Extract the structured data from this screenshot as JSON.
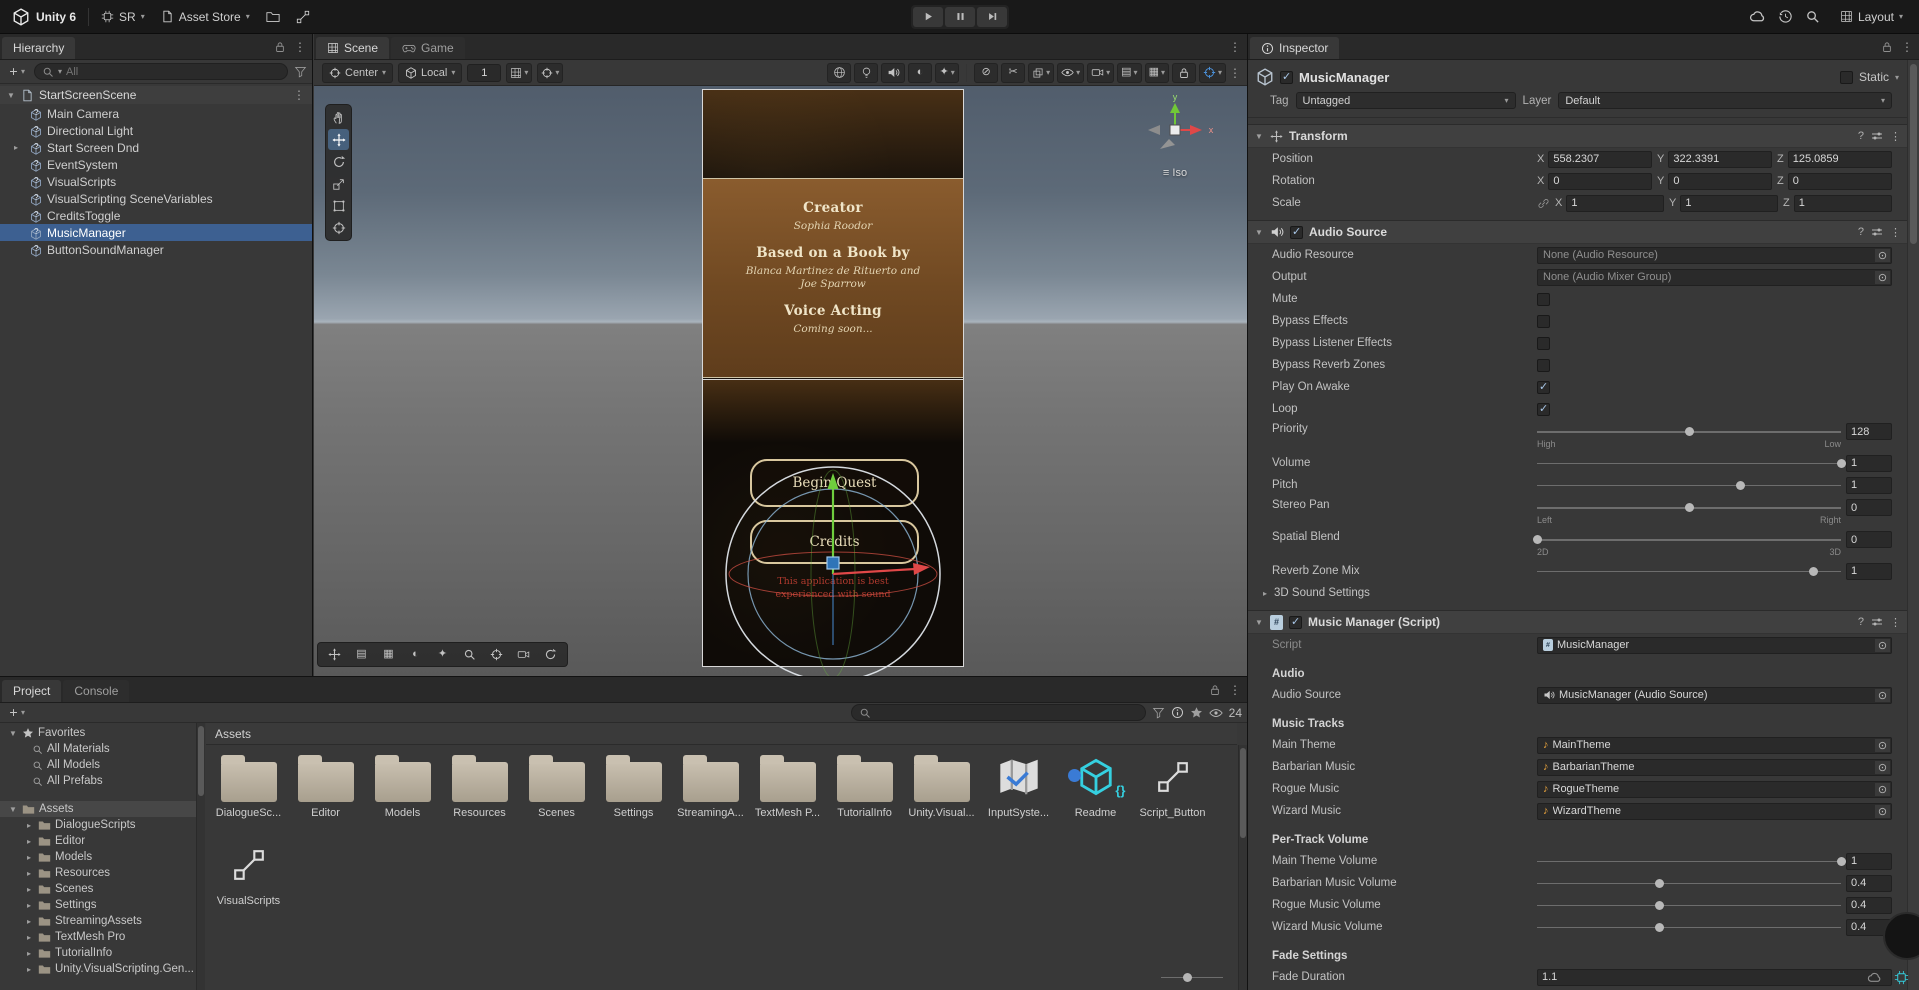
{
  "colors": {
    "selection_blue": "#3d6091",
    "accent_blue": "#4a90d9",
    "topbar_bg": "#191919",
    "panel_bg": "#383838",
    "folder_icon": "#b5ac9c",
    "audio_asset_orange": "#e8a33d",
    "visual_scripting_teal": "#35d0e0",
    "preview_panel_brown": "#7a5126",
    "preview_cream": "#ecdfc0",
    "preview_warning_red": "#b03a2e",
    "gizmo_green": "#6fce3e",
    "gizmo_red": "#e04848",
    "gizmo_blue": "#3a7bd5"
  },
  "topbar": {
    "app_title": "Unity 6",
    "sr_menu": "SR",
    "asset_store_menu": "Asset Store",
    "layout_menu": "Layout"
  },
  "hierarchy": {
    "tab_label": "Hierarchy",
    "search_placeholder": "All",
    "scene_name": "StartScreenScene",
    "items": [
      {
        "label": "Main Camera"
      },
      {
        "label": "Directional Light"
      },
      {
        "label": "Start Screen Dnd",
        "expandable": true
      },
      {
        "label": "EventSystem"
      },
      {
        "label": "VisualScripts"
      },
      {
        "label": "VisualScripting SceneVariables"
      },
      {
        "label": "CreditsToggle"
      },
      {
        "label": "MusicManager",
        "selected": true
      },
      {
        "label": "ButtonSoundManager"
      }
    ]
  },
  "scene": {
    "tab_scene": "Scene",
    "tab_game": "Game",
    "pivot_mode": "Center",
    "handle_orientation": "Local",
    "grid_size": "1",
    "projection_label": "Iso",
    "axis_labels": {
      "x": "x",
      "y": "y"
    },
    "preview": {
      "credits": {
        "heading_creator": "Creator",
        "creator_name": "Sophia Roodor",
        "heading_book": "Based on a Book by",
        "book_authors_line1": "Blanca Martinez de Rituerto and",
        "book_authors_line2": "Joe Sparrow",
        "heading_voice": "Voice Acting",
        "voice_note": "Coming soon..."
      },
      "begin_quest_button": "Begin Quest",
      "credits_button": "Credits",
      "sound_note_line1": "This application is best",
      "sound_note_line2": "experienced with sound"
    }
  },
  "project": {
    "tab_project": "Project",
    "tab_console": "Console",
    "favorites_label": "Favorites",
    "favorites": [
      {
        "label": "All Materials"
      },
      {
        "label": "All Models"
      },
      {
        "label": "All Prefabs"
      }
    ],
    "assets_root_label": "Assets",
    "folder_tree": [
      {
        "label": "DialogueScripts"
      },
      {
        "label": "Editor"
      },
      {
        "label": "Models"
      },
      {
        "label": "Resources"
      },
      {
        "label": "Scenes"
      },
      {
        "label": "Settings"
      },
      {
        "label": "StreamingAssets"
      },
      {
        "label": "TextMesh Pro"
      },
      {
        "label": "TutorialInfo"
      },
      {
        "label": "Unity.VisualScripting.Gen..."
      }
    ],
    "content_header": "Assets",
    "grid_items": [
      {
        "label": "DialogueSc...",
        "icon": "folder"
      },
      {
        "label": "Editor",
        "icon": "folder"
      },
      {
        "label": "Models",
        "icon": "folder"
      },
      {
        "label": "Resources",
        "icon": "folder"
      },
      {
        "label": "Scenes",
        "icon": "folder"
      },
      {
        "label": "Settings",
        "icon": "folder"
      },
      {
        "label": "StreamingA...",
        "icon": "folder"
      },
      {
        "label": "TextMesh P...",
        "icon": "folder"
      },
      {
        "label": "TutorialInfo",
        "icon": "folder"
      },
      {
        "label": "Unity.Visual...",
        "icon": "folder"
      },
      {
        "label": "InputSyste...",
        "icon": "input-asset"
      },
      {
        "label": "Readme",
        "icon": "readme"
      },
      {
        "label": "Script_Button",
        "icon": "script-graph"
      },
      {
        "label": "VisualScripts",
        "icon": "script-graph"
      }
    ],
    "visible_count": "24"
  },
  "inspector": {
    "tab_label": "Inspector",
    "object_name": "MusicManager",
    "static_label": "Static",
    "tag_label": "Tag",
    "tag_value": "Untagged",
    "layer_label": "Layer",
    "layer_value": "Default",
    "axis_labels": [
      "X",
      "Y",
      "Z"
    ],
    "sections": [
      {
        "title": "Transform",
        "icon": "transform",
        "has_enabled_checkbox": false,
        "rows": [
          {
            "type": "vector3",
            "label": "Position",
            "values": [
              "558.2307",
              "322.3391",
              "125.0859"
            ]
          },
          {
            "type": "vector3",
            "label": "Rotation",
            "values": [
              "0",
              "0",
              "0"
            ]
          },
          {
            "type": "vector3",
            "label": "Scale",
            "values": [
              "1",
              "1",
              "1"
            ],
            "linked": true
          }
        ]
      },
      {
        "title": "Audio Source",
        "icon": "speaker",
        "has_enabled_checkbox": true,
        "enabled": true,
        "rows": [
          {
            "type": "object",
            "label": "Audio Resource",
            "value": "None (Audio Resource)",
            "icon": "none",
            "empty": true
          },
          {
            "type": "object",
            "label": "Output",
            "value": "None (Audio Mixer Group)",
            "icon": "none",
            "empty": true
          },
          {
            "type": "checkbox",
            "label": "Mute",
            "checked": false
          },
          {
            "type": "checkbox",
            "label": "Bypass Effects",
            "checked": false
          },
          {
            "type": "checkbox",
            "label": "Bypass Listener Effects",
            "checked": false
          },
          {
            "type": "checkbox",
            "label": "Bypass Reverb Zones",
            "checked": false
          },
          {
            "type": "checkbox",
            "label": "Play On Awake",
            "checked": true
          },
          {
            "type": "checkbox",
            "label": "Loop",
            "checked": true
          },
          {
            "type": "slider",
            "label": "Priority",
            "value": "128",
            "min": 0,
            "max": 256,
            "sub_left": "High",
            "sub_right": "Low"
          },
          {
            "type": "slider",
            "label": "Volume",
            "value": "1",
            "min": 0,
            "max": 1
          },
          {
            "type": "slider",
            "label": "Pitch",
            "value": "1",
            "min": -3,
            "max": 3
          },
          {
            "type": "slider",
            "label": "Stereo Pan",
            "value": "0",
            "min": -1,
            "max": 1,
            "sub_left": "Left",
            "sub_right": "Right"
          },
          {
            "type": "slider",
            "label": "Spatial Blend",
            "value": "0",
            "min": 0,
            "max": 1,
            "sub_left": "2D",
            "sub_right": "3D"
          },
          {
            "type": "slider",
            "label": "Reverb Zone Mix",
            "value": "1",
            "min": 0,
            "max": 1.1
          },
          {
            "type": "foldout",
            "label": "3D Sound Settings"
          }
        ]
      },
      {
        "title": "Music Manager (Script)",
        "icon": "script",
        "has_enabled_checkbox": true,
        "enabled": true,
        "rows": [
          {
            "type": "object",
            "label": "Script",
            "value": "MusicManager",
            "icon": "script",
            "label_dim": true
          },
          {
            "type": "header",
            "label": "Audio"
          },
          {
            "type": "object",
            "label": "Audio Source",
            "value": "MusicManager (Audio Source)",
            "icon": "speaker"
          },
          {
            "type": "header",
            "label": "Music Tracks"
          },
          {
            "type": "object",
            "label": "Main Theme",
            "value": "MainTheme",
            "icon": "audio"
          },
          {
            "type": "object",
            "label": "Barbarian Music",
            "value": "BarbarianTheme",
            "icon": "audio"
          },
          {
            "type": "object",
            "label": "Rogue Music",
            "value": "RogueTheme",
            "icon": "audio"
          },
          {
            "type": "object",
            "label": "Wizard Music",
            "value": "WizardTheme",
            "icon": "audio"
          },
          {
            "type": "header",
            "label": "Per-Track Volume"
          },
          {
            "type": "slider",
            "label": "Main Theme Volume",
            "value": "1",
            "min": 0,
            "max": 1
          },
          {
            "type": "slider",
            "label": "Barbarian Music Volume",
            "value": "0.4",
            "min": 0,
            "max": 1
          },
          {
            "type": "slider",
            "label": "Rogue Music Volume",
            "value": "0.4",
            "min": 0,
            "max": 1
          },
          {
            "type": "slider",
            "label": "Wizard Music Volume",
            "value": "0.4",
            "min": 0,
            "max": 1
          },
          {
            "type": "header",
            "label": "Fade Settings"
          },
          {
            "type": "field",
            "label": "Fade Duration",
            "value": "1.1"
          }
        ]
      }
    ]
  }
}
